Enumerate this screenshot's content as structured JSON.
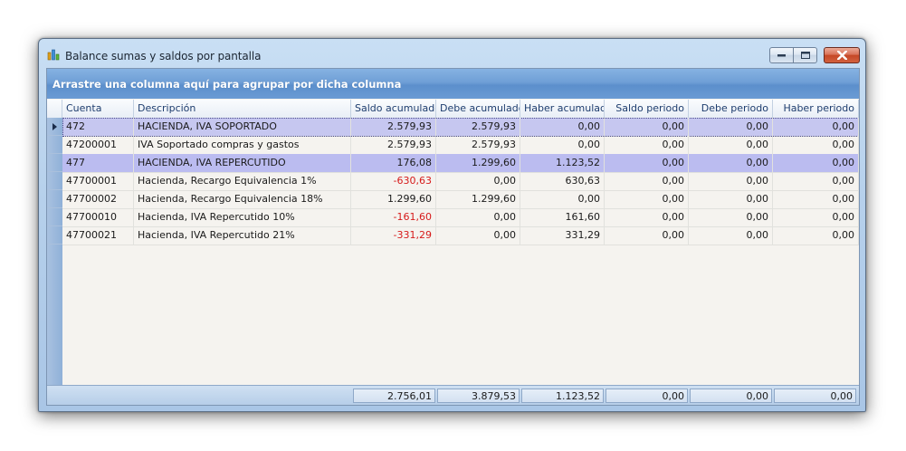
{
  "window": {
    "title": "Balance sumas y saldos por pantalla",
    "icon": "chart-bars-icon"
  },
  "group_panel": {
    "text": "Arrastre una columna aquí para agrupar por dicha columna"
  },
  "columns": [
    "Cuenta",
    "Descripción",
    "Saldo acumulado",
    "Debe acumulado",
    "Haber acumulado",
    "Saldo periodo",
    "Debe periodo",
    "Haber periodo"
  ],
  "rows": [
    [
      "472",
      "HACIENDA, IVA SOPORTADO",
      "2.579,93",
      "2.579,93",
      "0,00",
      "0,00",
      "0,00",
      "0,00"
    ],
    [
      "47200001",
      "IVA Soportado compras y gastos",
      "2.579,93",
      "2.579,93",
      "0,00",
      "0,00",
      "0,00",
      "0,00"
    ],
    [
      "477",
      "HACIENDA, IVA REPERCUTIDO",
      "176,08",
      "1.299,60",
      "1.123,52",
      "0,00",
      "0,00",
      "0,00"
    ],
    [
      "47700001",
      "Hacienda, Recargo Equivalencia 1%",
      "-630,63",
      "0,00",
      "630,63",
      "0,00",
      "0,00",
      "0,00"
    ],
    [
      "47700002",
      "Hacienda, Recargo Equivalencia 18%",
      "1.299,60",
      "1.299,60",
      "0,00",
      "0,00",
      "0,00",
      "0,00"
    ],
    [
      "47700010",
      "Hacienda, IVA Repercutido 10%",
      "-161,60",
      "0,00",
      "161,60",
      "0,00",
      "0,00",
      "0,00"
    ],
    [
      "47700021",
      "Hacienda, IVA Repercutido 21%",
      "-331,29",
      "0,00",
      "331,29",
      "0,00",
      "0,00",
      "0,00"
    ]
  ],
  "totals": [
    "2.756,01",
    "3.879,53",
    "1.123,52",
    "0,00",
    "0,00",
    "0,00"
  ],
  "colors": {
    "negative": "#d61a1a",
    "selected_row": "#c6c7f0",
    "highlight_row": "#bbbcf0",
    "header_text": "#1e3d6e",
    "group_panel": "#6f9fd6"
  }
}
